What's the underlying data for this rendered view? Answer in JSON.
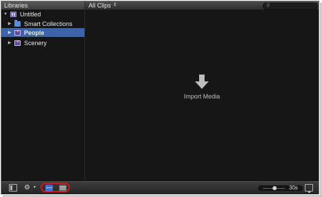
{
  "libraries_header": {
    "title": "Libraries"
  },
  "browser_header": {
    "filter_label": "All Clips"
  },
  "sidebar": {
    "items": [
      {
        "label": "Untitled",
        "icon": "library-icon",
        "expanded": true
      },
      {
        "label": "Smart Collections",
        "icon": "folder-icon",
        "expanded": false
      },
      {
        "label": "People",
        "icon": "event-icon",
        "expanded": false,
        "selected": true
      },
      {
        "label": "Scenery",
        "icon": "event-icon",
        "expanded": false
      }
    ]
  },
  "main": {
    "import_label": "Import Media"
  },
  "bottombar": {
    "zoom_label": "30s"
  },
  "colors": {
    "selection": "#3d64a8",
    "highlight_oval": "#d01818",
    "filmstrip_active": "#3a71d4"
  }
}
